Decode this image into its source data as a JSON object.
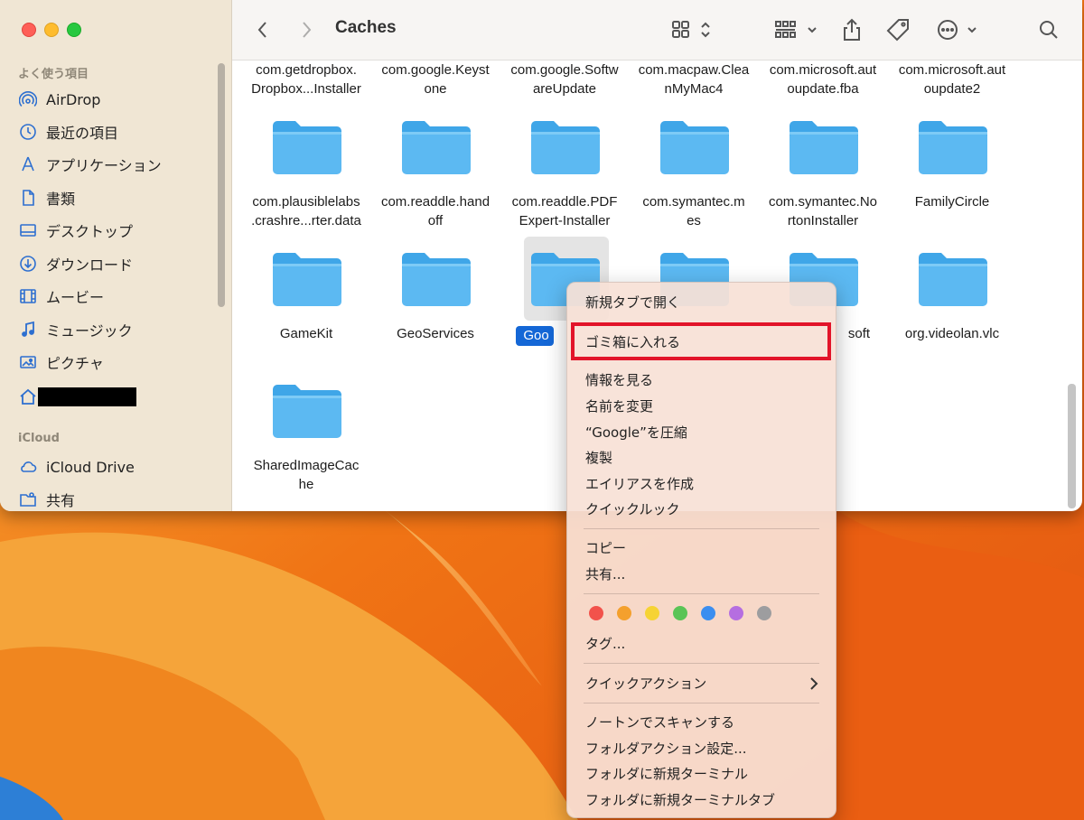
{
  "window": {
    "title": "Caches"
  },
  "sidebar": {
    "favorites_heading": "よく使う項目",
    "items": [
      {
        "label": "AirDrop",
        "icon": "airdrop-icon"
      },
      {
        "label": "最近の項目",
        "icon": "clock-icon"
      },
      {
        "label": "アプリケーション",
        "icon": "applications-icon"
      },
      {
        "label": "書類",
        "icon": "document-icon"
      },
      {
        "label": "デスクトップ",
        "icon": "desktop-icon"
      },
      {
        "label": "ダウンロード",
        "icon": "download-icon"
      },
      {
        "label": "ムービー",
        "icon": "film-icon"
      },
      {
        "label": "ミュージック",
        "icon": "music-icon"
      },
      {
        "label": "ピクチャ",
        "icon": "photo-icon"
      },
      {
        "label": "",
        "icon": "home-icon"
      }
    ],
    "icloud_heading": "iCloud",
    "icloud_items": [
      {
        "label": "iCloud Drive",
        "icon": "cloud-icon"
      },
      {
        "label": "共有",
        "icon": "shared-folder-icon"
      }
    ]
  },
  "content": {
    "top_row_labels": [
      [
        "com.getdropbox.",
        "Dropbox...Installer"
      ],
      [
        "com.google.Keyst",
        "one"
      ],
      [
        "com.google.Softw",
        "areUpdate"
      ],
      [
        "com.macpaw.Clea",
        "nMyMac4"
      ],
      [
        "com.microsoft.aut",
        "oupdate.fba"
      ],
      [
        "com.microsoft.aut",
        "oupdate2"
      ]
    ],
    "row2": [
      [
        "com.plausiblelabs",
        ".crashre...rter.data"
      ],
      [
        "com.readdle.hand",
        "off"
      ],
      [
        "com.readdle.PDF",
        "Expert-Installer"
      ],
      [
        "com.symantec.m",
        "es"
      ],
      [
        "com.symantec.No",
        "rtonInstaller"
      ],
      [
        "FamilyCircle",
        ""
      ]
    ],
    "row3": [
      [
        "GameKit",
        ""
      ],
      [
        "GeoServices",
        ""
      ],
      [
        "Goo",
        ""
      ],
      [
        "",
        ""
      ],
      [
        "soft",
        ""
      ],
      [
        "org.videolan.vlc",
        ""
      ]
    ],
    "row4": [
      [
        "SharedImageCac",
        "he"
      ]
    ],
    "selected_label": "Goo"
  },
  "context_menu": {
    "items": {
      "open_new_tab": "新規タブで開く",
      "move_to_trash": "ゴミ箱に入れる",
      "get_info": "情報を見る",
      "rename": "名前を変更",
      "compress": "“Google”を圧縮",
      "duplicate": "複製",
      "make_alias": "エイリアスを作成",
      "quick_look": "クイックルック",
      "copy": "コピー",
      "share": "共有...",
      "tags": "タグ...",
      "quick_actions": "クイックアクション",
      "norton_scan": "ノートンでスキャンする",
      "folder_action_setup": "フォルダアクション設定...",
      "new_terminal": "フォルダに新規ターミナル",
      "new_terminal_tab": "フォルダに新規ターミナルタブ"
    },
    "tag_colors": [
      "#f2524b",
      "#f4a02d",
      "#f6d334",
      "#5ac456",
      "#3b8ef0",
      "#b56ee0",
      "#9d9d9f"
    ],
    "highlight_color": "#e2142a"
  }
}
